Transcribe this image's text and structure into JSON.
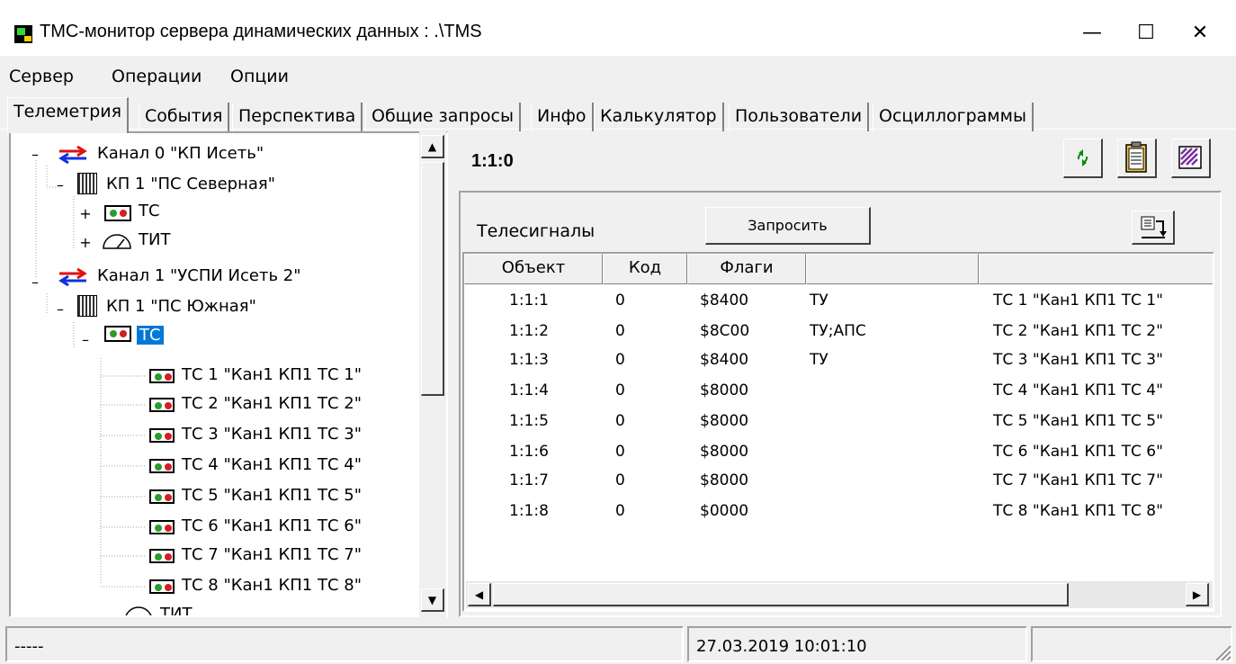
{
  "window": {
    "title": "ТМС-монитор сервера динамических данных :  .\\TMS",
    "minimize": "—",
    "maximize": "☐",
    "close": "✕"
  },
  "menu": [
    "Сервер",
    "Операции",
    "Опции"
  ],
  "tabs": [
    "Телеметрия",
    "События",
    "Перспектива",
    "Общие запросы",
    "Инфо",
    "Калькулятор",
    "Пользователи",
    "Осциллограммы"
  ],
  "tree": {
    "expand_minus": "–",
    "expand_plus": "+",
    "channel0": "Канал 0 \"КП Исеть\"",
    "kp0": "КП 1 \"ПС Северная\"",
    "tc0": "ТС",
    "tit0": "ТИТ",
    "channel1": "Канал 1 \"УСПИ Исеть 2\"",
    "kp1": "КП 1 \"ПС Южная\"",
    "tc1": "ТС",
    "items": [
      "ТС 1 \"Кан1 КП1 ТС 1\"",
      "ТС 2 \"Кан1 КП1 ТС 2\"",
      "ТС 3 \"Кан1 КП1 ТС 3\"",
      "ТС 4 \"Кан1 КП1 ТС 4\"",
      "ТС 5 \"Кан1 КП1 ТС 5\"",
      "ТС 6 \"Кан1 КП1 ТС 6\"",
      "ТС 7 \"Кан1 КП1 ТС 7\"",
      "ТС 8 \"Кан1 КП1 ТС 8\""
    ],
    "tit1": "ТИТ"
  },
  "scroll": {
    "up": "▲",
    "down": "▼",
    "left": "◀",
    "right": "▶"
  },
  "detail": {
    "address": "1:1:0",
    "section": "Телесигналы",
    "request_button": "Запросить",
    "columns": [
      "Объект",
      "Код",
      "Флаги",
      "",
      ""
    ],
    "rows": [
      [
        "1:1:1",
        "0",
        "$8400",
        "ТУ",
        "ТС 1 \"Кан1 КП1 ТС 1\""
      ],
      [
        "1:1:2",
        "0",
        "$8C00",
        "ТУ;АПС",
        "ТС 2 \"Кан1 КП1 ТС 2\""
      ],
      [
        "1:1:3",
        "0",
        "$8400",
        "ТУ",
        "ТС 3 \"Кан1 КП1 ТС 3\""
      ],
      [
        "1:1:4",
        "0",
        "$8000",
        "",
        "ТС 4 \"Кан1 КП1 ТС 4\""
      ],
      [
        "1:1:5",
        "0",
        "$8000",
        "",
        "ТС 5 \"Кан1 КП1 ТС 5\""
      ],
      [
        "1:1:6",
        "0",
        "$8000",
        "",
        "ТС 6 \"Кан1 КП1 ТС 6\""
      ],
      [
        "1:1:7",
        "0",
        "$8000",
        "",
        "ТС 7 \"Кан1 КП1 ТС 7\""
      ],
      [
        "1:1:8",
        "0",
        "$0000",
        "",
        "ТС 8 \"Кан1 КП1 ТС 8\""
      ]
    ]
  },
  "toolbar_icons": [
    "refresh-icon",
    "clipboard-icon",
    "pattern-icon",
    "export-icon"
  ],
  "status": {
    "left": "-----",
    "datetime": "27.03.2019 10:01:10",
    "right": ""
  },
  "colors": {
    "selection": "#0078d7",
    "window_bg": "#f0f0f0"
  }
}
